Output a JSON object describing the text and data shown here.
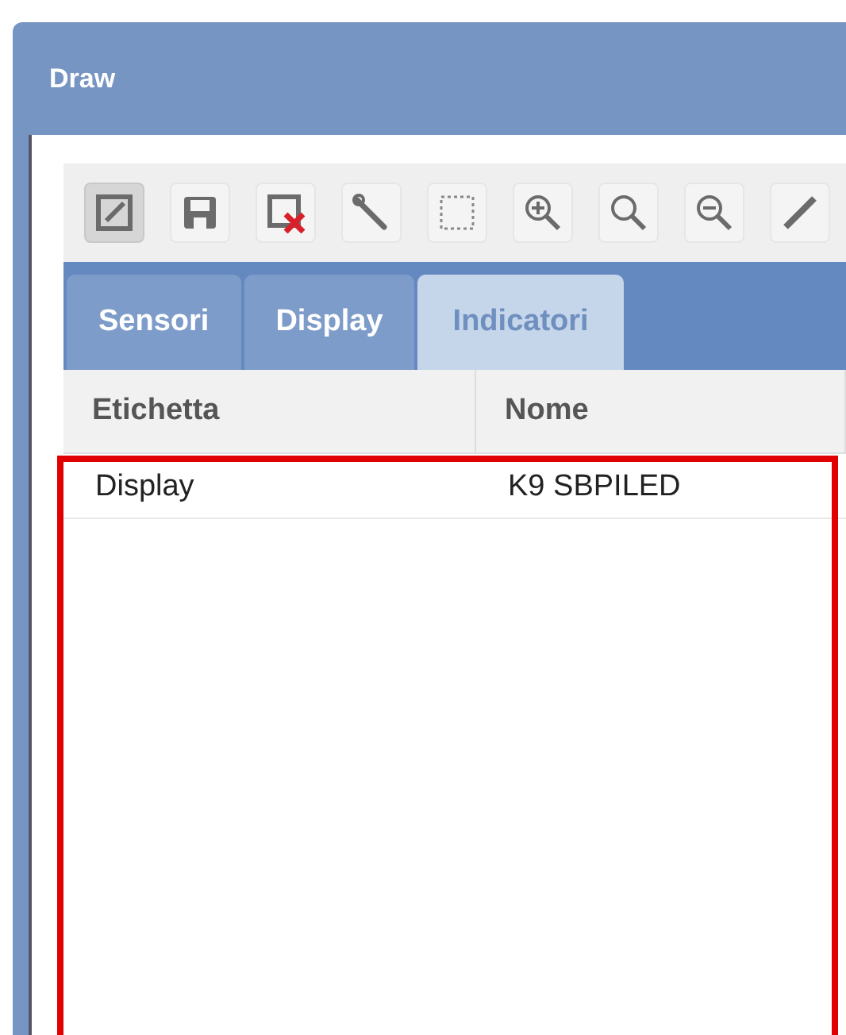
{
  "window": {
    "title": "Draw"
  },
  "toolbar": [
    {
      "kind": "edit",
      "selected": true
    },
    {
      "kind": "save",
      "selected": false
    },
    {
      "kind": "delete",
      "selected": false
    },
    {
      "kind": "wrench",
      "selected": false
    },
    {
      "kind": "select",
      "selected": false
    },
    {
      "kind": "zoom-in",
      "selected": false
    },
    {
      "kind": "search",
      "selected": false
    },
    {
      "kind": "zoom-out",
      "selected": false
    },
    {
      "kind": "pencil",
      "selected": false
    }
  ],
  "tabs": [
    {
      "label": "Sensori",
      "selected": false
    },
    {
      "label": "Display",
      "selected": false
    },
    {
      "label": "Indicatori",
      "selected": true
    }
  ],
  "table": {
    "columns": [
      "Etichetta",
      "Nome"
    ],
    "rows": [
      [
        "Display",
        "K9 SBPILED"
      ]
    ]
  },
  "highlight": {
    "visible": true
  }
}
